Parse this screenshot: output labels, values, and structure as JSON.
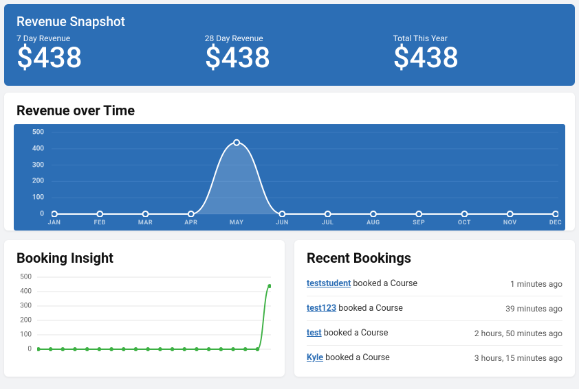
{
  "snapshot": {
    "title": "Revenue Snapshot",
    "metrics": [
      {
        "label": "7 Day Revenue",
        "value": "$438"
      },
      {
        "label": "28 Day Revenue",
        "value": "$438"
      },
      {
        "label": "Total This Year",
        "value": "$438"
      }
    ]
  },
  "revenue_over_time": {
    "title": "Revenue over Time"
  },
  "booking_insight": {
    "title": "Booking Insight"
  },
  "recent_bookings": {
    "title": "Recent Bookings",
    "items": [
      {
        "user": "teststudent",
        "action": " booked a Course",
        "time": "1 minutes ago"
      },
      {
        "user": "test123",
        "action": " booked a Course",
        "time": "39 minutes ago"
      },
      {
        "user": "test",
        "action": " booked a Course",
        "time": "2 hours, 50 minutes ago"
      },
      {
        "user": "Kyle",
        "action": " booked a Course",
        "time": "3 hours, 15 minutes ago"
      }
    ]
  },
  "chart_data": [
    {
      "type": "line",
      "name": "revenue_over_time",
      "title": "Revenue over Time",
      "categories": [
        "JAN",
        "FEB",
        "MAR",
        "APR",
        "MAY",
        "JUN",
        "JUL",
        "AUG",
        "SEP",
        "OCT",
        "NOV",
        "DEC"
      ],
      "values": [
        0,
        0,
        0,
        0,
        438,
        0,
        0,
        0,
        0,
        0,
        0,
        0
      ],
      "ylabel": "",
      "xlabel": "",
      "ylim": [
        0,
        500
      ],
      "yticks": [
        0,
        100,
        200,
        300,
        400,
        500
      ],
      "colors": {
        "line": "#ffffff",
        "bg": "#2c6eb5"
      }
    },
    {
      "type": "line",
      "name": "booking_insight",
      "title": "Booking Insight",
      "x": [
        1,
        2,
        3,
        4,
        5,
        6,
        7,
        8,
        9,
        10,
        11,
        12,
        13,
        14,
        15,
        16,
        17,
        18,
        19,
        20
      ],
      "values": [
        0,
        0,
        0,
        0,
        0,
        0,
        0,
        0,
        0,
        0,
        0,
        0,
        0,
        0,
        0,
        0,
        0,
        0,
        0,
        438
      ],
      "ylabel": "",
      "xlabel": "",
      "ylim": [
        0,
        500
      ],
      "yticks": [
        0,
        100,
        200,
        300,
        400,
        500
      ],
      "colors": {
        "line": "#3cb043"
      }
    }
  ]
}
